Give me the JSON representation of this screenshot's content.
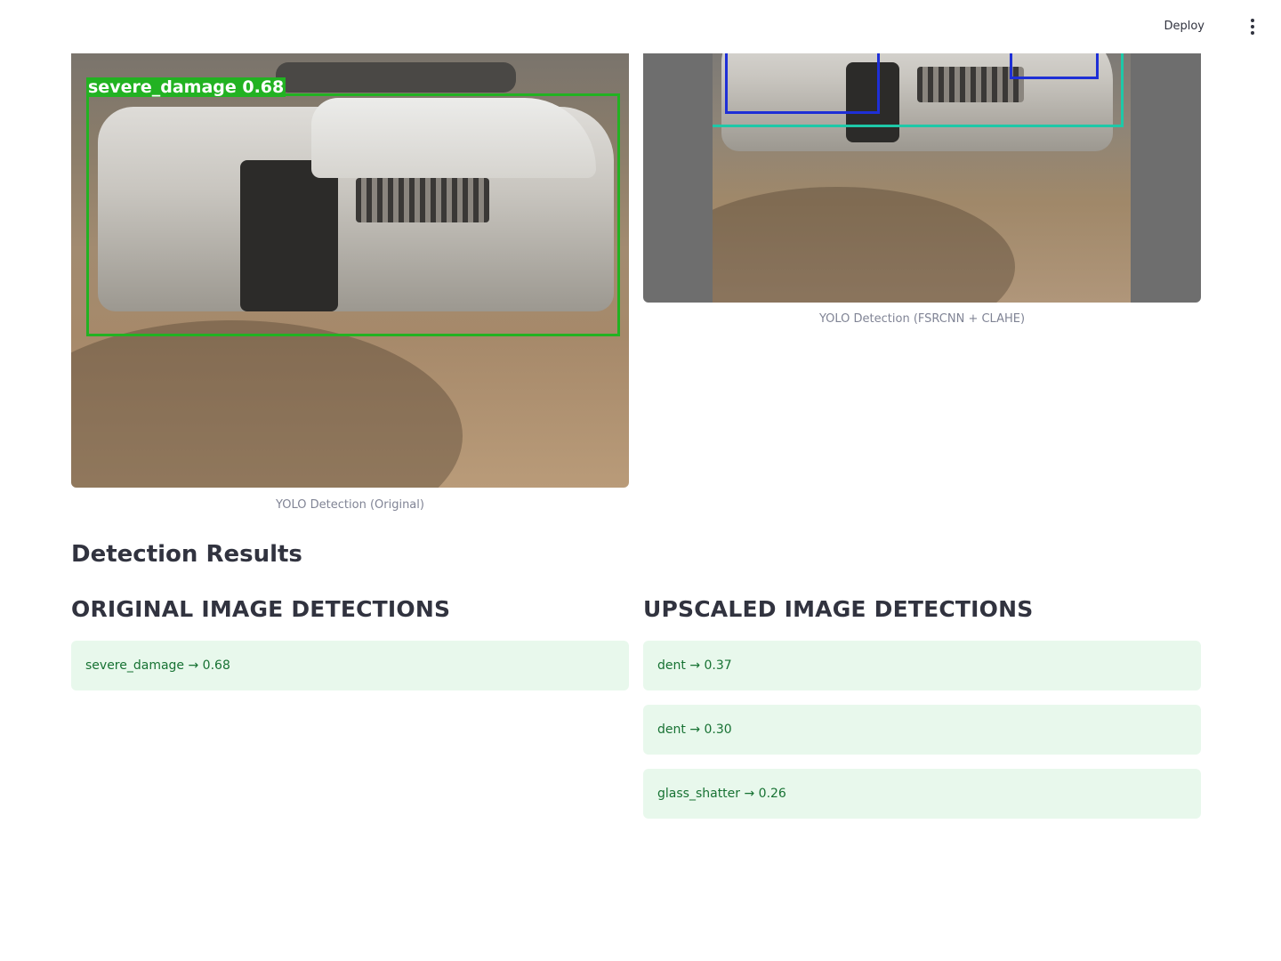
{
  "header": {
    "deploy_label": "Deploy",
    "menu_icon": "more-vert-icon"
  },
  "images": {
    "original": {
      "caption": "YOLO Detection (Original)",
      "box_label": "severe_damage  0.68",
      "box_color": "#22b222"
    },
    "upscaled": {
      "caption": "YOLO Detection (FSRCNN + CLAHE)",
      "box_colors": [
        "#1e2fd6",
        "#1ec8a8"
      ]
    }
  },
  "results": {
    "title": "Detection Results",
    "original": {
      "heading": "ORIGINAL IMAGE DETECTIONS",
      "items": [
        {
          "text": "severe_damage → 0.68"
        }
      ]
    },
    "upscaled": {
      "heading": "UPSCALED IMAGE DETECTIONS",
      "items": [
        {
          "text": "dent → 0.37"
        },
        {
          "text": "dent → 0.30"
        },
        {
          "text": "glass_shatter → 0.26"
        }
      ]
    }
  },
  "colors": {
    "success_bg": "#e8f8ec",
    "success_text": "#177233",
    "caption_text": "#808495"
  }
}
